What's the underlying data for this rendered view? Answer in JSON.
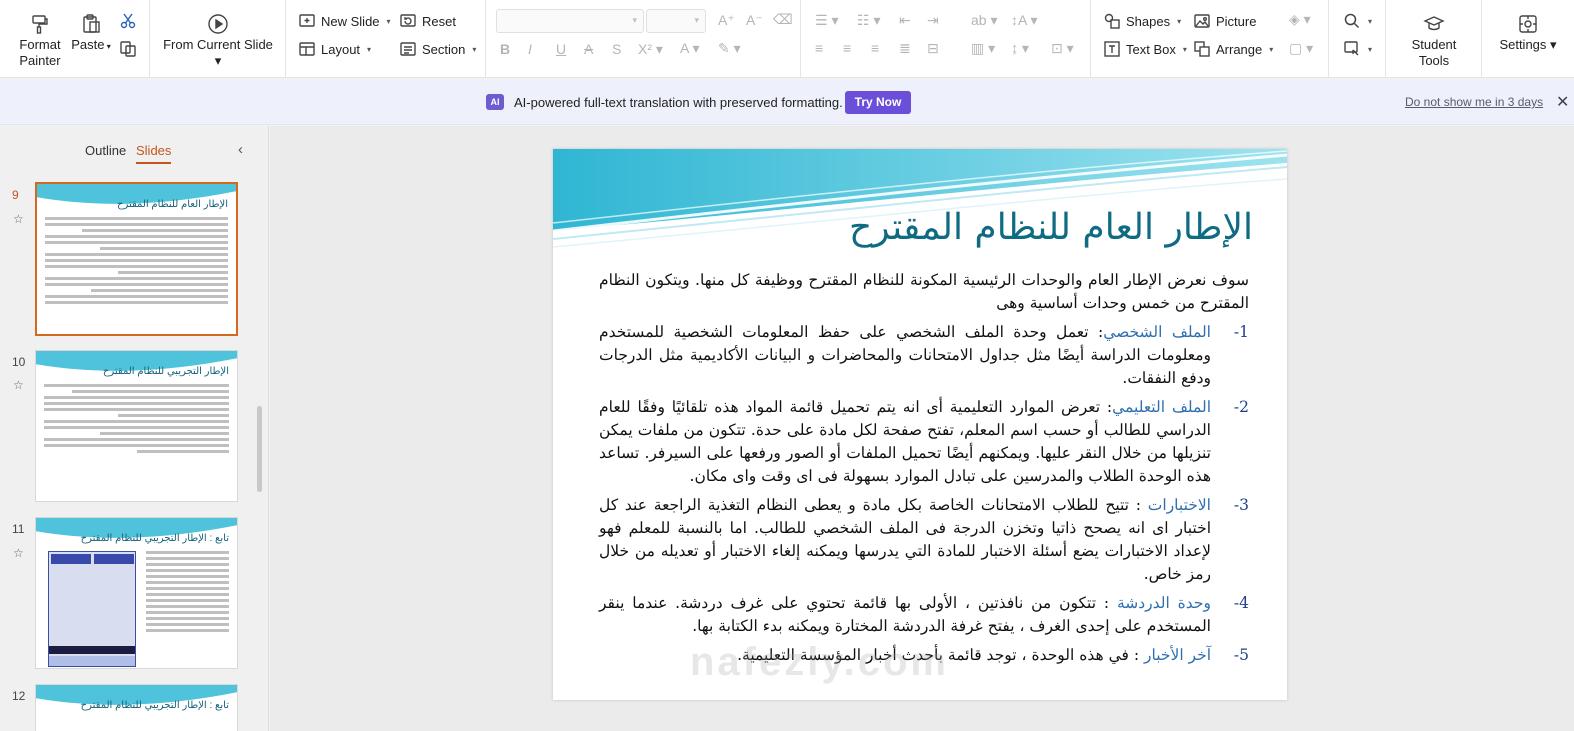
{
  "ribbon": {
    "format_painter": "Format\nPainter",
    "paste": "Paste",
    "from_current_slide": "From Current Slide",
    "new_slide": "New  Slide",
    "reset": "Reset",
    "layout": "Layout",
    "section": "Section",
    "shapes": "Shapes",
    "picture": "Picture",
    "text_box": "Text Box",
    "arrange": "Arrange",
    "student_tools": "Student Tools",
    "settings": "Settings"
  },
  "notice": {
    "badge": "AI",
    "message": "AI-powered full-text translation with preserved formatting.",
    "try_now": "Try Now",
    "dismiss": "Do not show me in 3 days"
  },
  "side_pane": {
    "tab_outline": "Outline",
    "tab_slides": "Slides",
    "slides": [
      {
        "number": "9",
        "title": "الإطار العام للنظام المقترح",
        "selected": true
      },
      {
        "number": "10",
        "title": "الإطار التجريبي للنظام المقترح",
        "selected": false
      },
      {
        "number": "11",
        "title": "تابع : الإطار التجريبي للنظام المقترح",
        "selected": false
      },
      {
        "number": "12",
        "title": "تابع : الإطار التجريبي للنظام المقترح",
        "selected": false
      }
    ]
  },
  "slide": {
    "title": "الإطار العام للنظام المقترح",
    "intro": "سوف نعرض الإطار العام والوحدات الرئيسية المكونة للنظام المقترح ووظيفة كل منها. ويتكون النظام المقترح من خمس وحدات أساسية وهى",
    "items": [
      {
        "num": "1-",
        "keyword": "الملف الشخصي",
        "text": ": تعمل وحدة الملف الشخصي على حفظ المعلومات الشخصية للمستخدم ومعلومات الدراسة أيضًا مثل جداول الامتحانات والمحاضرات و البيانات الأكاديمية مثل الدرجات ودفع النفقات."
      },
      {
        "num": "2-",
        "keyword": "الملف التعليمي",
        "text": ": تعرض الموارد التعليمية أى انه يتم تحميل قائمة المواد هذه تلقائيًا وفقًا للعام الدراسي للطالب أو حسب اسم المعلم، تفتح صفحة لكل مادة على حدة. تتكون من ملفات يمكن تنزيلها من خلال النقر عليها. ويمكنهم أيضًا تحميل الملفات أو الصور ورفعها على السيرفر. تساعد هذه الوحدة الطلاب والمدرسين على تبادل الموارد بسهولة فى اى وقت واى مكان."
      },
      {
        "num": "3-",
        "keyword": "الاختبارات",
        "text": " : تتيح للطلاب الامتحانات الخاصة بكل مادة و يعطى النظام التغذية الراجعة عند كل اختبار اى انه يصحح ذاتيا وتخزن الدرجة فى الملف الشخصي للطالب. اما بالنسبة للمعلم فهو لإعداد الاختبارات يضع أسئلة الاختبار للمادة التي يدرسها ويمكنه إلغاء الاختبار أو تعديله من خلال رمز خاص."
      },
      {
        "num": "4-",
        "keyword": "وحدة الدردشة",
        "text": " : تتكون من نافذتين ، الأولى بها قائمة تحتوي على غرف دردشة. عندما ينقر المستخدم على إحدى الغرف ، يفتح غرفة الدردشة المختارة ويمكنه بدء الكتابة بها."
      },
      {
        "num": "5-",
        "keyword": "آخر الأخبار",
        "text": " : في هذه الوحدة ، توجد قائمة بأحدث أخبار المؤسسة التعليمية."
      }
    ]
  },
  "watermark": "nafezly.com",
  "colors": {
    "accent": "#c2561d",
    "title": "#0f6b82",
    "keyword": "#2f6fb0",
    "try_button": "#6b4fd8"
  }
}
